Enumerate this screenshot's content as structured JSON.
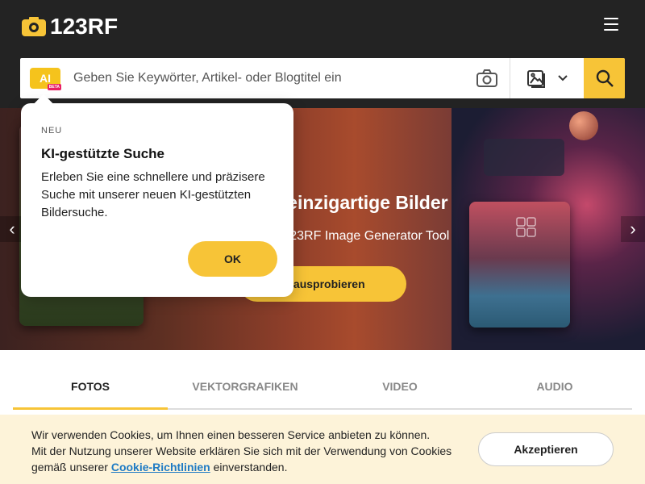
{
  "header": {
    "logo_text": "123RF",
    "menu_icon": "hamburger-icon"
  },
  "search": {
    "ai_label": "AI",
    "ai_beta": "BETA",
    "placeholder": "Geben Sie Keywörter, Artikel- oder Blogtitel ein",
    "camera_icon": "camera-icon",
    "type_icon": "image-icon",
    "search_icon": "search-icon"
  },
  "hero": {
    "title": "e einzigartige Bilder",
    "subtitle": "n 123RF Image Generator Tool",
    "cta": "zt ausprobieren"
  },
  "popover": {
    "tag": "NEU",
    "title": "KI-gestützte Suche",
    "text": "Erleben Sie eine schnellere und präzisere Suche mit unserer neuen KI-gestützten Bildersuche.",
    "ok": "OK"
  },
  "tabs": [
    {
      "label": "FOTOS",
      "active": true
    },
    {
      "label": "VEKTORGRAFIKEN",
      "active": false
    },
    {
      "label": "VIDEO",
      "active": false
    },
    {
      "label": "AUDIO",
      "active": false
    }
  ],
  "cookie": {
    "line1": "Wir verwenden Cookies, um Ihnen einen besseren Service anbieten zu können.",
    "line2": "Mit der Nutzung unserer Website erklären Sie sich mit der Verwendung von Cookies",
    "line3_pre": "gemäß unserer",
    "link": "Cookie-Richtlinien",
    "line3_post": "einverstanden.",
    "accept": "Akzeptieren"
  },
  "colors": {
    "header_bg": "#232323",
    "accent": "#f7c437",
    "cookie_bg": "#fdf3d9",
    "link": "#1f7bc4"
  }
}
